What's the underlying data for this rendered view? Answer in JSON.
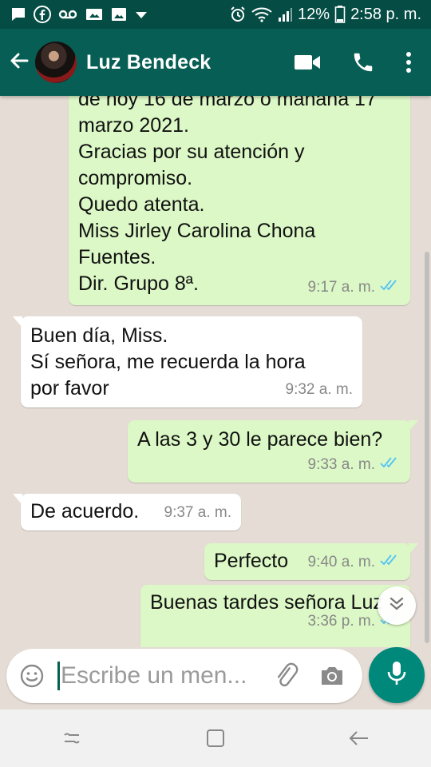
{
  "status_bar": {
    "battery": "12%",
    "time": "2:58 p. m."
  },
  "header": {
    "contact_name": "Luz Bendeck",
    "icons": [
      "back-arrow-icon",
      "video-call-icon",
      "phone-icon",
      "more-vert-icon"
    ]
  },
  "messages": [
    {
      "direction": "outgoing",
      "text": "de hoy 16 de marzo o mañana 17\nmarzo 2021.\nGracias por su atención y\ncompromiso.\nQuedo atenta.\nMiss Jirley Carolina Chona\nFuentes.\nDir. Grupo 8ª.",
      "time": "9:17 a. m.",
      "status": "read"
    },
    {
      "direction": "incoming",
      "text": "Buen día, Miss.\nSí señora, me recuerda la hora\npor favor",
      "time": "9:32 a. m."
    },
    {
      "direction": "outgoing",
      "text": "A las 3 y 30 le parece bien?",
      "time": "9:33 a. m.",
      "status": "read"
    },
    {
      "direction": "incoming",
      "text": "De acuerdo.",
      "time": "9:37 a. m."
    },
    {
      "direction": "outgoing",
      "text": "Perfecto",
      "time": "9:40 a. m.",
      "status": "read"
    },
    {
      "direction": "outgoing",
      "text": "Buenas tardes señora Luz",
      "time": "3:36 p. m.",
      "status": "read"
    }
  ],
  "composer": {
    "placeholder": "Escribe un men..."
  },
  "colors": {
    "header": "#075e54",
    "status_bar": "#054d44",
    "chat_background": "#e5ddd5",
    "outgoing_bubble": "#dcf8c6",
    "incoming_bubble": "#ffffff",
    "read_ticks": "#4fc3f7",
    "mic_button": "#00897b"
  }
}
